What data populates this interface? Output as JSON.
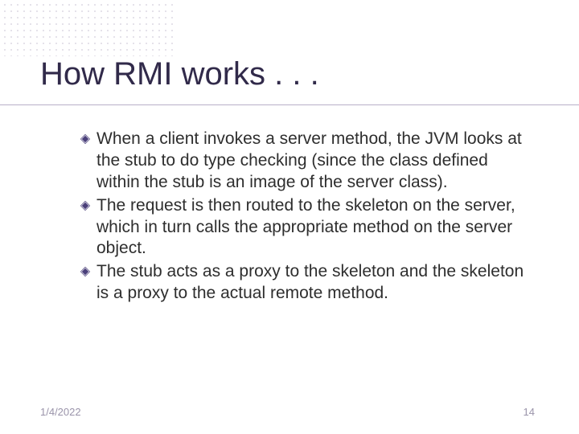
{
  "title": "How RMI works . . .",
  "bullets": [
    "When a client invokes a server method, the JVM looks at the stub to do type checking (since the class defined within the stub is an image of the server class).",
    "The request is then routed to the skeleton on the server, which in turn calls the appropriate method on the server object.",
    "The stub acts as a proxy to the skeleton and the skeleton is a proxy to the actual remote method."
  ],
  "footer": {
    "date": "1/4/2022",
    "page": "14"
  }
}
